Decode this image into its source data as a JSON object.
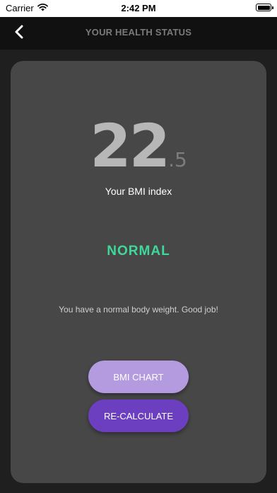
{
  "status_bar": {
    "carrier": "Carrier",
    "time": "2:42 PM",
    "icons": [
      "wifi-icon",
      "battery-icon"
    ]
  },
  "nav": {
    "back_icon": "chevron-left-icon",
    "title": "YOUR HEALTH STATUS"
  },
  "result": {
    "bmi_whole": "22",
    "bmi_decimal": ".5",
    "bmi_caption": "Your BMI index",
    "status": "NORMAL",
    "message": "You have a normal body weight. Good job!"
  },
  "buttons": {
    "chart_label": "BMI CHART",
    "recalc_label": "RE-CALCULATE"
  },
  "colors": {
    "status_color": "#3ed89b",
    "chart_button": "#b49be0",
    "recalc_button": "#6c3fc0",
    "card_bg": "#474747"
  }
}
